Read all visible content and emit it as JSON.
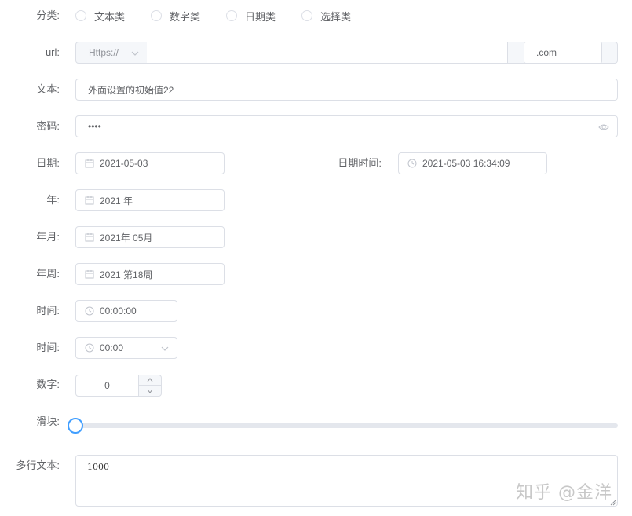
{
  "form": {
    "category": {
      "label": "分类:",
      "options": [
        "文本类",
        "数字类",
        "日期类",
        "选择类"
      ]
    },
    "url": {
      "label": "url:",
      "protocol": "Https://",
      "value": "",
      "suffix": ".com"
    },
    "text": {
      "label": "文本:",
      "value": "外面设置的初始值22"
    },
    "password": {
      "label": "密码:",
      "value": "••••"
    },
    "date": {
      "label": "日期:",
      "value": "2021-05-03"
    },
    "datetime": {
      "label": "日期时间:",
      "value": "2021-05-03 16:34:09"
    },
    "year": {
      "label": "年:",
      "value": "2021 年"
    },
    "month": {
      "label": "年月:",
      "value": "2021年 05月"
    },
    "week": {
      "label": "年周:",
      "value": "2021 第18周"
    },
    "time": {
      "label": "时间:",
      "value": "00:00:00"
    },
    "time_select": {
      "label": "时间:",
      "value": "00:00"
    },
    "number": {
      "label": "数字:",
      "value": "0"
    },
    "slider": {
      "label": "滑块:",
      "value": 0
    },
    "textarea": {
      "label": "多行文本:",
      "value": "1000"
    }
  },
  "watermark": "知乎 @金洋",
  "colors": {
    "accent": "#409eff",
    "border": "#dcdfe6",
    "text": "#606266"
  },
  "icons": [
    "calendar-icon",
    "clock-icon",
    "eye-icon",
    "chevron-down-icon",
    "arrow-up-icon",
    "arrow-down-icon"
  ]
}
